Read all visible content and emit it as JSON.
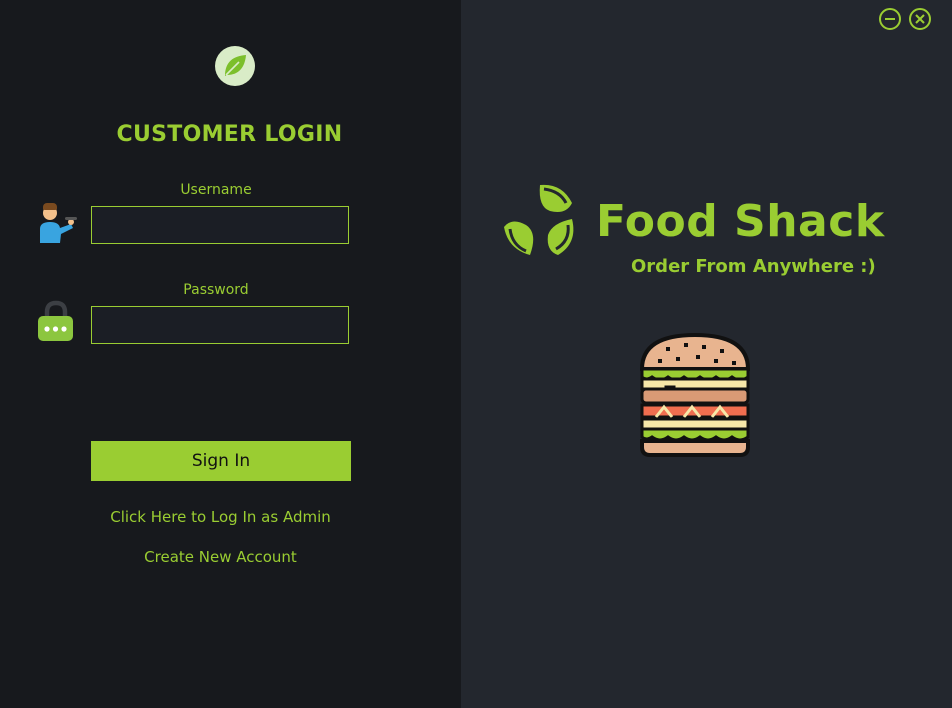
{
  "login": {
    "title": "CUSTOMER LOGIN",
    "username_label": "Username",
    "username_value": "",
    "password_label": "Password",
    "password_value": "",
    "sign_in_label": "Sign In",
    "admin_link": "Click Here to Log In as Admin",
    "create_account_link": "Create New Account"
  },
  "brand": {
    "name": "Food Shack",
    "tagline": "Order From Anywhere :)"
  },
  "icons": {
    "top_left": "leaf-icon",
    "username": "user-icon",
    "password": "lock-icon",
    "brand": "brand-logo-icon",
    "illustration": "burger-icon",
    "minimize": "minimize-icon",
    "close": "close-icon"
  },
  "colors": {
    "accent": "#9acd32",
    "left_panel": "#17191d",
    "right_panel": "#23272e",
    "input_bg": "#1b1e25"
  }
}
